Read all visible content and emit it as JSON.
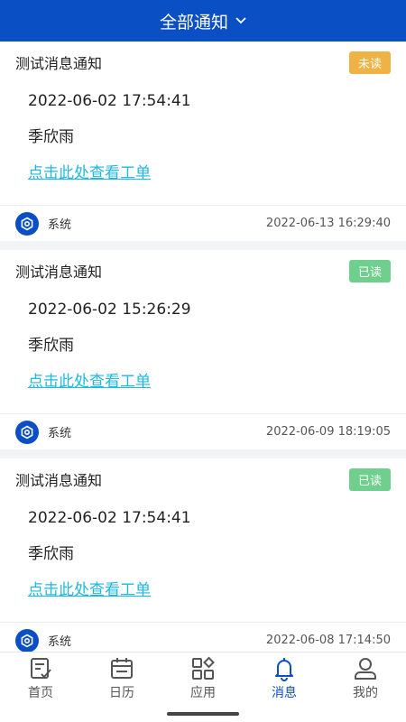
{
  "header": {
    "title": "全部通知"
  },
  "notifications": [
    {
      "title": "测试消息通知",
      "status": "未读",
      "status_type": "unread",
      "datetime": "2022-06-02 17:54:41",
      "person": "季欣雨",
      "link": "点击此处查看工单",
      "sender": "系统",
      "time": "2022-06-13 16:29:40"
    },
    {
      "title": "测试消息通知",
      "status": "已读",
      "status_type": "read",
      "datetime": "2022-06-02 15:26:29",
      "person": "季欣雨",
      "link": "点击此处查看工单",
      "sender": "系统",
      "time": "2022-06-09 18:19:05"
    },
    {
      "title": "测试消息通知",
      "status": "已读",
      "status_type": "read",
      "datetime": "2022-06-02 17:54:41",
      "person": "季欣雨",
      "link": "点击此处查看工单",
      "sender": "系统",
      "time": "2022-06-08 17:14:50"
    }
  ],
  "tabs": [
    {
      "label": "首页",
      "icon": "home-icon"
    },
    {
      "label": "日历",
      "icon": "calendar-icon"
    },
    {
      "label": "应用",
      "icon": "apps-icon"
    },
    {
      "label": "消息",
      "icon": "bell-icon",
      "active": true
    },
    {
      "label": "我的",
      "icon": "user-icon"
    }
  ],
  "colors": {
    "primary": "#0a4fc4",
    "unread": "#efb244",
    "read": "#6ed08c",
    "link": "#1fb8e0"
  }
}
